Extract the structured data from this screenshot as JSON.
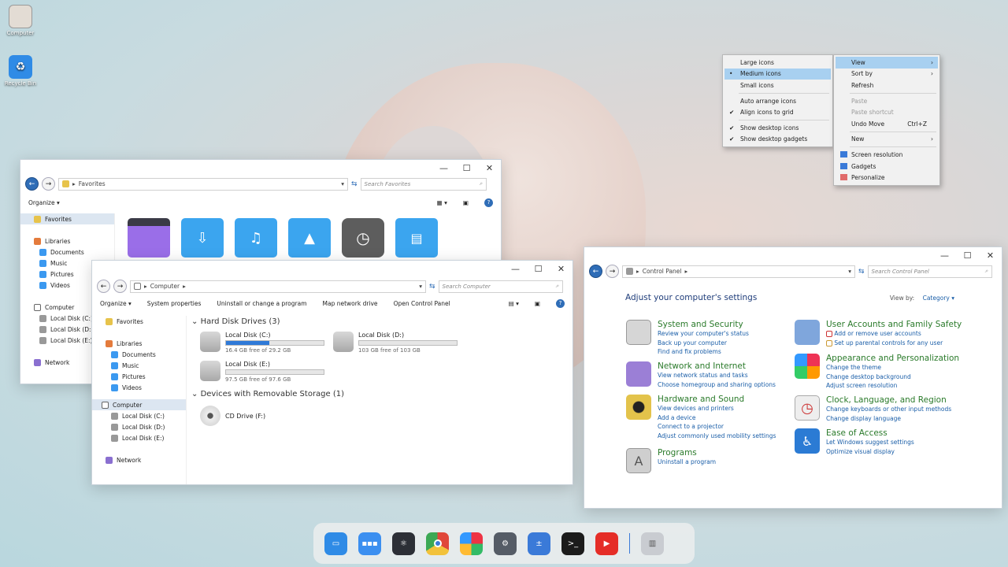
{
  "desktop": {
    "icons": [
      {
        "label": "Computer",
        "icon": "folder-icon"
      },
      {
        "label": "Recycle Bin",
        "icon": "recycle-bin-icon"
      }
    ]
  },
  "context_menu": {
    "main": [
      {
        "label": "View",
        "submenu": true,
        "highlighted": true
      },
      {
        "label": "Sort by",
        "submenu": true
      },
      {
        "label": "Refresh"
      },
      {
        "label": "Paste",
        "disabled": true
      },
      {
        "label": "Paste shortcut",
        "disabled": true
      },
      {
        "label": "Undo Move",
        "shortcut": "Ctrl+Z"
      },
      {
        "label": "New",
        "submenu": true
      },
      {
        "label": "Screen resolution"
      },
      {
        "label": "Gadgets"
      },
      {
        "label": "Personalize"
      }
    ],
    "view_submenu": [
      {
        "label": "Large icons"
      },
      {
        "label": "Medium icons",
        "mark": "•"
      },
      {
        "label": "Small icons"
      },
      {
        "label": "Auto arrange icons"
      },
      {
        "label": "Align icons to grid",
        "mark": "✔"
      },
      {
        "label": "Show desktop icons",
        "mark": "✔"
      },
      {
        "label": "Show desktop gadgets",
        "mark": "✔"
      }
    ]
  },
  "favorites_window": {
    "address": "Favorites",
    "search_placeholder": "Search Favorites",
    "organize": "Organize",
    "sidebar": {
      "favorites": "Favorites",
      "libraries": "Libraries",
      "library_items": [
        "Documents",
        "Music",
        "Pictures",
        "Videos"
      ],
      "computer": "Computer",
      "drives": [
        "Local Disk (C:)",
        "Local Disk (D:)",
        "Local Disk (E:)"
      ],
      "network": "Network"
    }
  },
  "computer_window": {
    "address": "Computer",
    "search_placeholder": "Search Computer",
    "toolbar": [
      "Organize",
      "System properties",
      "Uninstall or change a program",
      "Map network drive",
      "Open Control Panel"
    ],
    "sidebar": {
      "favorites": "Favorites",
      "libraries": "Libraries",
      "library_items": [
        "Documents",
        "Music",
        "Pictures",
        "Videos"
      ],
      "computer": "Computer",
      "drives": [
        "Local Disk (C:)",
        "Local Disk (D:)",
        "Local Disk (E:)"
      ],
      "network": "Network"
    },
    "hdd_group": "Hard Disk Drives (3)",
    "drives": [
      {
        "name": "Local Disk (C:)",
        "free": "16.4 GB free of 29.2 GB",
        "used_fraction": 0.44
      },
      {
        "name": "Local Disk (D:)",
        "free": "103 GB free of 103 GB",
        "used_fraction": 0.0
      },
      {
        "name": "Local Disk (E:)",
        "free": "97.5 GB free of 97.6 GB",
        "used_fraction": 0.0
      }
    ],
    "removable_group": "Devices with Removable Storage (1)",
    "cd_drive": "CD Drive (F:)"
  },
  "control_panel": {
    "address": "Control Panel",
    "search_placeholder": "Search Control Panel",
    "heading": "Adjust your computer's settings",
    "view_by_label": "View by:",
    "view_by_value": "Category",
    "categories_left": [
      {
        "title": "System and Security",
        "links": [
          "Review your computer's status",
          "Back up your computer",
          "Find and fix problems"
        ],
        "color": "#c9c9c9"
      },
      {
        "title": "Network and Internet",
        "links": [
          "View network status and tasks",
          "Choose homegroup and sharing options"
        ],
        "color": "#9b7fd6"
      },
      {
        "title": "Hardware and Sound",
        "links": [
          "View devices and printers",
          "Add a device",
          "Connect to a projector",
          "Adjust commonly used mobility settings"
        ],
        "color": "#e3c34b"
      },
      {
        "title": "Programs",
        "links": [
          "Uninstall a program"
        ],
        "color": "#b9b9b9"
      }
    ],
    "categories_right": [
      {
        "title": "User Accounts and Family Safety",
        "links": [
          "Add or remove user accounts",
          "Set up parental controls for any user"
        ],
        "color": "#7fa6dc"
      },
      {
        "title": "Appearance and Personalization",
        "links": [
          "Change the theme",
          "Change desktop background",
          "Adjust screen resolution"
        ],
        "color": "#e06a6a"
      },
      {
        "title": "Clock, Language, and Region",
        "links": [
          "Change keyboards or other input methods",
          "Change display language"
        ],
        "color": "#dcdcdc"
      },
      {
        "title": "Ease of Access",
        "links": [
          "Let Windows suggest settings",
          "Optimize visual display"
        ],
        "color": "#2b7bd4"
      }
    ]
  },
  "dock": {
    "apps": [
      {
        "icon": "file-manager-icon",
        "color": "#2f8be6"
      },
      {
        "icon": "apps-grid-icon",
        "color": "#3b8ff0"
      },
      {
        "icon": "atom-icon",
        "color": "#2c2f36"
      },
      {
        "icon": "chrome-icon",
        "color": "#e0473a"
      },
      {
        "icon": "store-icon",
        "color": "#f2a93b"
      },
      {
        "icon": "settings-icon",
        "color": "#555c66"
      },
      {
        "icon": "calculator-icon",
        "color": "#3a7ad8"
      },
      {
        "icon": "terminal-icon",
        "color": "#1b1b1b"
      },
      {
        "icon": "youtube-icon",
        "color": "#e52d27"
      },
      {
        "icon": "trash-icon",
        "color": "#c9ccd1"
      }
    ]
  }
}
